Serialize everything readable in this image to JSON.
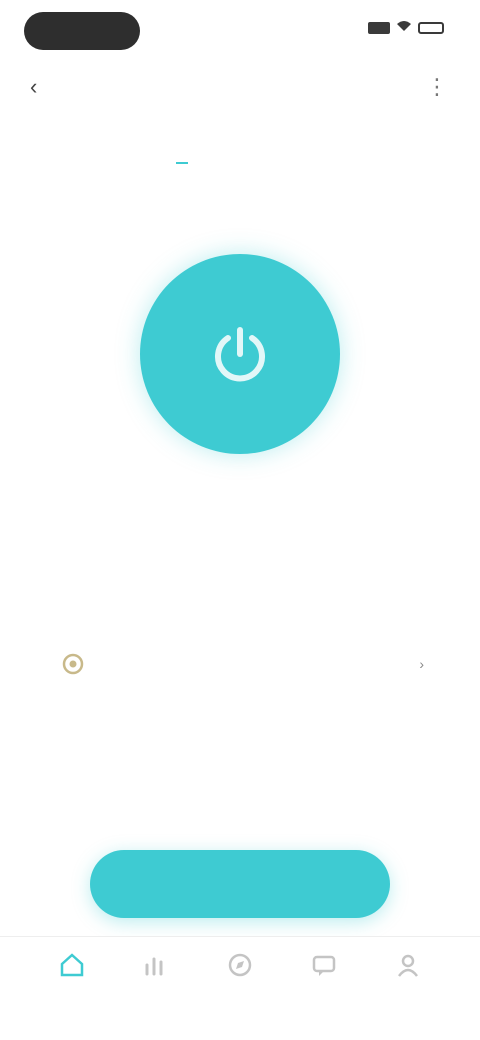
{
  "status_bar": {
    "time": "",
    "indicators": [
      "signal-icon",
      "wifi-icon",
      "battery-icon"
    ]
  },
  "nav": {
    "title": "",
    "back_icon": "back-arrow-icon",
    "more_icon": "more-icon"
  },
  "tabs": [
    {
      "label": "",
      "active": true
    },
    {
      "label": "",
      "active": false
    },
    {
      "label": "",
      "active": false
    }
  ],
  "main": {
    "circle_icon": "power-icon",
    "circle_label": "",
    "settings_row": {
      "icon": "gear-icon",
      "label": "",
      "value": "",
      "chevron_icon": "chevron-right-icon"
    },
    "hint": "",
    "cta_label": ""
  },
  "tabbar": [
    {
      "label": "",
      "icon": "home-icon",
      "active": true
    },
    {
      "label": "",
      "icon": "chart-icon",
      "active": false
    },
    {
      "label": "",
      "icon": "compass-icon",
      "active": false
    },
    {
      "label": "",
      "icon": "message-icon",
      "active": false
    },
    {
      "label": "",
      "icon": "user-icon",
      "active": false
    }
  ],
  "colors": {
    "accent": "#3ecbd2",
    "text": "#333333",
    "muted": "#999999",
    "status_pill": "#2e2e2e"
  }
}
